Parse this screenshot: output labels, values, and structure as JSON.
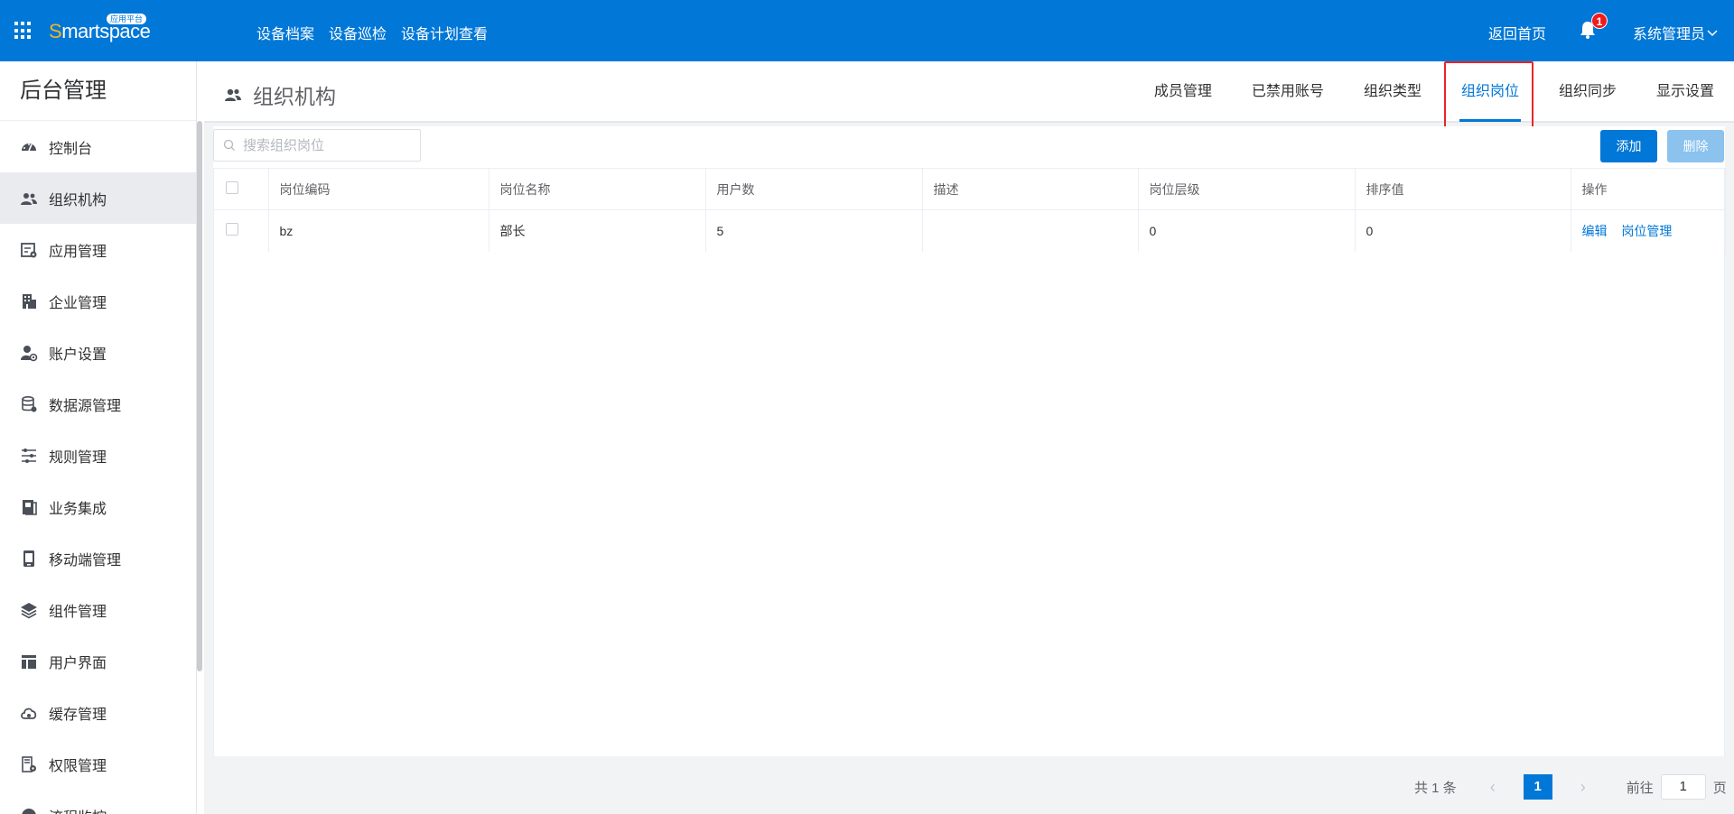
{
  "app": {
    "logo_first": "S",
    "logo_rest": "martspace",
    "logo_badge": "应用平台",
    "top_nav": [
      "设备档案",
      "设备巡检",
      "设备计划查看"
    ],
    "home_link": "返回首页",
    "notification_count": "1",
    "user_name": "系统管理员"
  },
  "sidebar": {
    "title": "后台管理",
    "items": [
      {
        "label": "控制台",
        "icon": "dashboard-icon"
      },
      {
        "label": "组织机构",
        "icon": "people-icon",
        "active": true
      },
      {
        "label": "应用管理",
        "icon": "app-settings-icon"
      },
      {
        "label": "企业管理",
        "icon": "building-icon"
      },
      {
        "label": "账户设置",
        "icon": "user-settings-icon"
      },
      {
        "label": "数据源管理",
        "icon": "database-icon"
      },
      {
        "label": "规则管理",
        "icon": "rules-icon"
      },
      {
        "label": "业务集成",
        "icon": "book-icon"
      },
      {
        "label": "移动端管理",
        "icon": "mobile-icon"
      },
      {
        "label": "组件管理",
        "icon": "layers-icon"
      },
      {
        "label": "用户界面",
        "icon": "layout-icon"
      },
      {
        "label": "缓存管理",
        "icon": "cloud-icon"
      },
      {
        "label": "权限管理",
        "icon": "permission-icon"
      },
      {
        "label": "流程监控",
        "icon": "monitor-icon"
      }
    ]
  },
  "header": {
    "title": "组织机构",
    "tabs": [
      "成员管理",
      "已禁用账号",
      "组织类型",
      "组织岗位",
      "组织同步",
      "显示设置"
    ],
    "active_tab": "组织岗位"
  },
  "toolbar": {
    "search_placeholder": "搜索组织岗位",
    "add_label": "添加",
    "delete_label": "删除"
  },
  "table": {
    "columns": [
      "岗位编码",
      "岗位名称",
      "用户数",
      "描述",
      "岗位层级",
      "排序值",
      "操作"
    ],
    "rows": [
      {
        "code": "bz",
        "name": "部长",
        "users": "5",
        "desc": "",
        "level": "0",
        "order": "0",
        "actions": [
          "编辑",
          "岗位管理"
        ]
      }
    ]
  },
  "pagination": {
    "total_label": "共 1 条",
    "current_page": "1",
    "goto_label": "前往",
    "goto_value": "1",
    "page_suffix": "页"
  },
  "colors": {
    "primary": "#0177d7",
    "highlight": "#e9242a",
    "badge": "#f01b1b"
  }
}
